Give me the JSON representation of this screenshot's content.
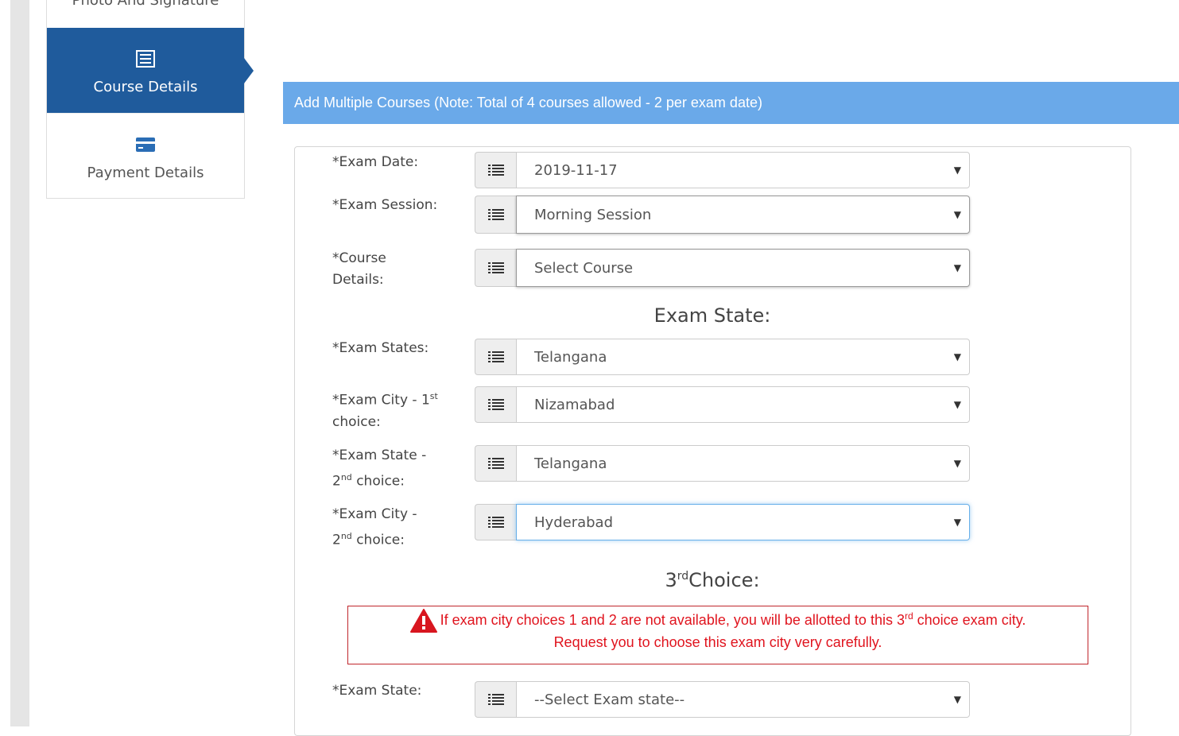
{
  "sidebar": {
    "top_label": "Photo And Signature",
    "course_label": "Course Details",
    "payment_label": "Payment Details"
  },
  "banner": {
    "text": "Add Multiple Courses (Note: Total of 4 courses allowed - 2 per exam date)"
  },
  "form": {
    "exam_date": {
      "label": "*Exam Date:",
      "value": "2019-11-17"
    },
    "exam_session": {
      "label": "*Exam Session:",
      "value": "Morning Session"
    },
    "course": {
      "label_line1": "*Course",
      "label_line2": "Details:",
      "value": "Select Course"
    },
    "exam_state_heading": "Exam State:",
    "exam_states": {
      "label": "*Exam States:",
      "value": "Telangana"
    },
    "city1": {
      "label_a": "*Exam City - 1",
      "label_sup": "st",
      "label_b": "choice:",
      "value": "Nizamabad"
    },
    "state2": {
      "label_a": "*Exam State -",
      "label_b": "2",
      "label_sup": "nd",
      "label_c": " choice:",
      "value": "Telangana"
    },
    "city2": {
      "label_a": "*Exam City -",
      "label_b": "2",
      "label_sup": "nd",
      "label_c": " choice:",
      "value": "Hyderabad"
    },
    "third_heading_pre": "3",
    "third_heading_sup": "rd",
    "third_heading_post": "Choice:",
    "warning": {
      "line1_pre": "If exam city choices 1 and 2 are not available, you will be allotted to this 3",
      "line1_sup": "rd",
      "line1_post": " choice exam city.",
      "line2": "Request you to choose this exam city very carefully."
    },
    "state3": {
      "label": "*Exam State:",
      "value": "--Select Exam state--"
    }
  },
  "colors": {
    "sidebar_active": "#1f5b9c",
    "banner": "#6aa9e9",
    "warning": "#e0141e"
  }
}
